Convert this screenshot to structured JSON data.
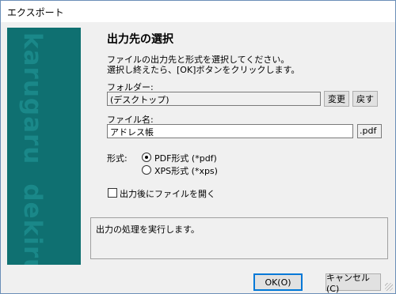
{
  "window": {
    "title": "エクスポート"
  },
  "banner": {
    "word1": "karugaru",
    "word2": "dekiru"
  },
  "main": {
    "heading": "出力先の選択",
    "desc_line1": "ファイルの出力先と形式を選択してください。",
    "desc_line2": "選択し終えたら、[OK]ボタンをクリックします。"
  },
  "folder": {
    "label": "フォルダー:",
    "value": "(デスクトップ)",
    "change_label": "変更",
    "reset_label": "戻す"
  },
  "filename": {
    "label": "ファイル名:",
    "value": "アドレス帳",
    "extension": ".pdf"
  },
  "format": {
    "label": "形式:",
    "options": [
      {
        "label": "PDF形式 (*pdf)",
        "selected": true
      },
      {
        "label": "XPS形式 (*xps)",
        "selected": false
      }
    ]
  },
  "open_after": {
    "label": "出力後にファイルを開く",
    "checked": false
  },
  "status": {
    "text": "出力の処理を実行します。"
  },
  "buttons": {
    "ok": "OK(O)",
    "cancel": "キャンセル(C)"
  },
  "colors": {
    "banner": "#0f7071",
    "accent": "#0078d7"
  }
}
